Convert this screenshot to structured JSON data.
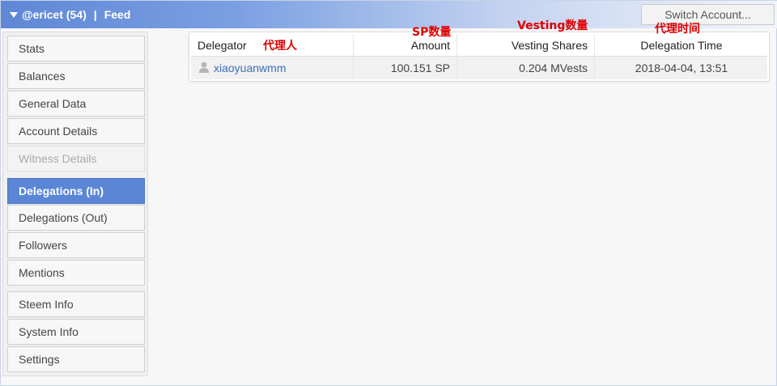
{
  "header": {
    "account": "@ericet (54)",
    "separator": "|",
    "feed": "Feed",
    "switch_account": "Switch Account..."
  },
  "sidebar": {
    "items": [
      {
        "label": "Stats",
        "state": "normal"
      },
      {
        "label": "Balances",
        "state": "normal"
      },
      {
        "label": "General Data",
        "state": "normal"
      },
      {
        "label": "Account Details",
        "state": "normal"
      },
      {
        "label": "Witness Details",
        "state": "disabled"
      },
      {
        "label": "Delegations (In)",
        "state": "active"
      },
      {
        "label": "Delegations (Out)",
        "state": "normal"
      },
      {
        "label": "Followers",
        "state": "normal"
      },
      {
        "label": "Mentions",
        "state": "normal"
      },
      {
        "label": "Steem Info",
        "state": "normal"
      },
      {
        "label": "System Info",
        "state": "normal"
      },
      {
        "label": "Settings",
        "state": "normal"
      }
    ]
  },
  "table": {
    "columns": [
      "Delegator",
      "Amount",
      "Vesting Shares",
      "Delegation Time"
    ],
    "rows": [
      {
        "delegator": "xiaoyuanwmm",
        "amount": "100.151 SP",
        "vesting_shares": "0.204 MVests",
        "delegation_time": "2018-04-04, 13:51",
        "icon": "person-icon"
      }
    ]
  },
  "annotations": {
    "delegator": "代理人",
    "amount": "SP数量",
    "vesting": "Vesting数量",
    "time": "代理时间"
  },
  "colors": {
    "accent": "#5b86d6",
    "link": "#3b6fb6",
    "annotation": "#e00000"
  }
}
